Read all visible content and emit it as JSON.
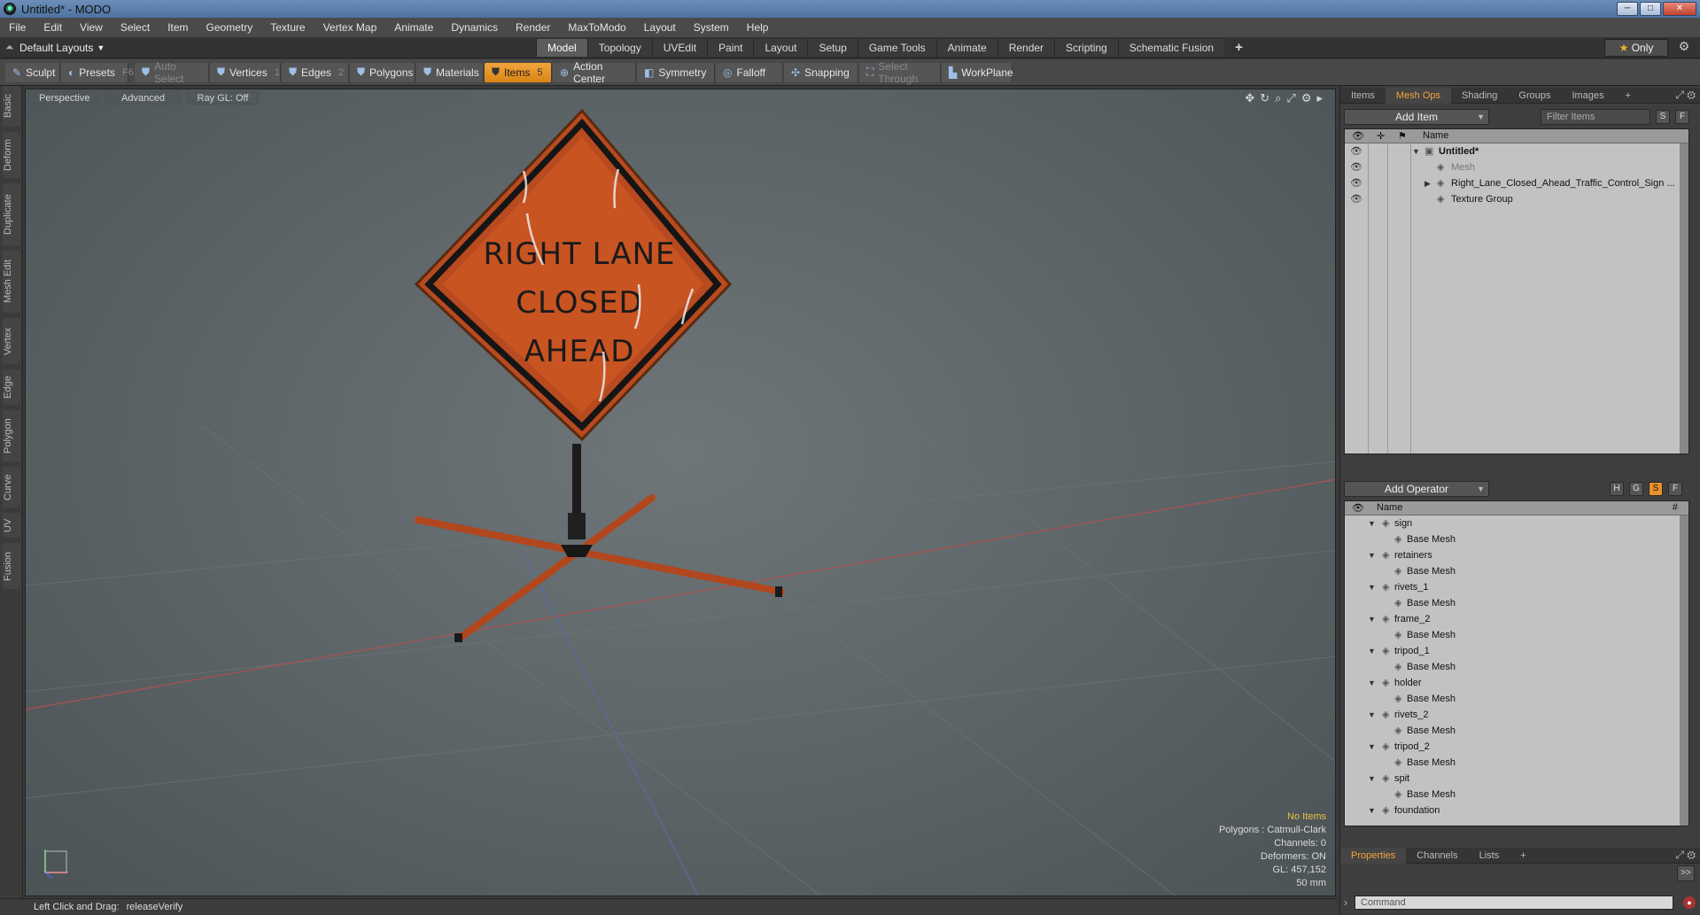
{
  "window": {
    "title": "Untitled* - MODO",
    "buttons": [
      "─",
      "□",
      "✕"
    ]
  },
  "menu": [
    "File",
    "Edit",
    "View",
    "Select",
    "Item",
    "Geometry",
    "Texture",
    "Vertex Map",
    "Animate",
    "Dynamics",
    "Render",
    "MaxToModo",
    "Layout",
    "System",
    "Help"
  ],
  "layout": {
    "label": "Default Layouts",
    "tabs": [
      "Model",
      "Topology",
      "UVEdit",
      "Paint",
      "Layout",
      "Setup",
      "Game Tools",
      "Animate",
      "Render",
      "Scripting",
      "Schematic Fusion"
    ],
    "active": "Model",
    "plus": "+",
    "only": "Only"
  },
  "toolbar": {
    "sculpt": "Sculpt",
    "presets": "Presets",
    "presets_key": "F6",
    "auto_select": "Auto Select",
    "vertices": "Vertices",
    "vertices_count": "1",
    "edges": "Edges",
    "edges_count": "2",
    "polygons": "Polygons",
    "materials": "Materials",
    "items": "Items",
    "items_count": "5",
    "action_center": "Action Center",
    "symmetry": "Symmetry",
    "falloff": "Falloff",
    "snapping": "Snapping",
    "select_through": "Select Through",
    "workplane": "WorkPlane"
  },
  "left_tabs": [
    "Basic",
    "Deform",
    "Duplicate",
    "Mesh Edit",
    "Vertex",
    "Edge",
    "Polygon",
    "Curve",
    "UV",
    "Fusion"
  ],
  "viewport": {
    "view": "Perspective",
    "mode": "Advanced",
    "raygl": "Ray GL: Off",
    "info": {
      "no_items": "No Items",
      "polygons": "Polygons : Catmull-Clark",
      "channels": "Channels: 0",
      "deformers": "Deformers: ON",
      "gl": "GL: 457,152",
      "scale": "50 mm"
    },
    "sign_lines": [
      "RIGHT LANE",
      "CLOSED",
      "AHEAD"
    ],
    "colors": {
      "sign": "#c24a1c",
      "border": "#1a1a1a",
      "legs": "#c04a20"
    }
  },
  "status": {
    "label": "Left Click and Drag:",
    "value": "releaseVerify"
  },
  "items_panel": {
    "tabs": [
      "Items",
      "Mesh Ops",
      "Shading",
      "Groups",
      "Images",
      "+"
    ],
    "active": "Mesh Ops",
    "add_item": "Add Item",
    "filter": "Filter Items",
    "s": "S",
    "f": "F",
    "col_name": "Name",
    "tree": [
      {
        "name": "Untitled*",
        "level": 0,
        "bold": true
      },
      {
        "name": "Mesh",
        "level": 1,
        "dim": true
      },
      {
        "name": "Right_Lane_Closed_Ahead_Traffic_Control_Sign ...",
        "level": 1
      },
      {
        "name": "Texture Group",
        "level": 1
      }
    ]
  },
  "ops_panel": {
    "add_operator": "Add Operator",
    "h": "H",
    "g": "G",
    "s": "S",
    "f": "F",
    "col_name": "Name",
    "col_hash": "#",
    "tree": [
      {
        "name": "sign",
        "level": 0
      },
      {
        "name": "Base Mesh",
        "level": 1
      },
      {
        "name": "retainers",
        "level": 0
      },
      {
        "name": "Base Mesh",
        "level": 1
      },
      {
        "name": "rivets_1",
        "level": 0
      },
      {
        "name": "Base Mesh",
        "level": 1
      },
      {
        "name": "frame_2",
        "level": 0
      },
      {
        "name": "Base Mesh",
        "level": 1
      },
      {
        "name": "tripod_1",
        "level": 0
      },
      {
        "name": "Base Mesh",
        "level": 1
      },
      {
        "name": "holder",
        "level": 0
      },
      {
        "name": "Base Mesh",
        "level": 1
      },
      {
        "name": "rivets_2",
        "level": 0
      },
      {
        "name": "Base Mesh",
        "level": 1
      },
      {
        "name": "tripod_2",
        "level": 0
      },
      {
        "name": "Base Mesh",
        "level": 1
      },
      {
        "name": "spit",
        "level": 0
      },
      {
        "name": "Base Mesh",
        "level": 1
      },
      {
        "name": "foundation",
        "level": 0
      }
    ]
  },
  "props_panel": {
    "tabs": [
      "Properties",
      "Channels",
      "Lists",
      "+"
    ],
    "active": "Properties",
    "expand": ">>"
  },
  "command": {
    "placeholder": "Command"
  }
}
